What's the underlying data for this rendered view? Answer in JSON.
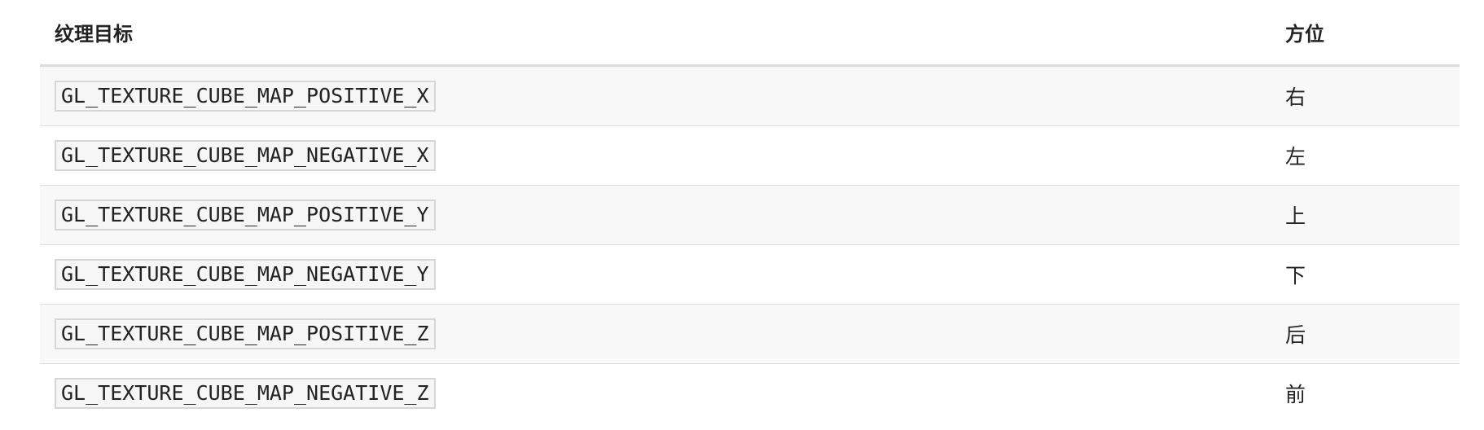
{
  "table": {
    "headers": {
      "target": "纹理目标",
      "direction": "方位"
    },
    "rows": [
      {
        "target": "GL_TEXTURE_CUBE_MAP_POSITIVE_X",
        "direction": "右"
      },
      {
        "target": "GL_TEXTURE_CUBE_MAP_NEGATIVE_X",
        "direction": "左"
      },
      {
        "target": "GL_TEXTURE_CUBE_MAP_POSITIVE_Y",
        "direction": "上"
      },
      {
        "target": "GL_TEXTURE_CUBE_MAP_NEGATIVE_Y",
        "direction": "下"
      },
      {
        "target": "GL_TEXTURE_CUBE_MAP_POSITIVE_Z",
        "direction": "后"
      },
      {
        "target": "GL_TEXTURE_CUBE_MAP_NEGATIVE_Z",
        "direction": "前"
      }
    ]
  }
}
